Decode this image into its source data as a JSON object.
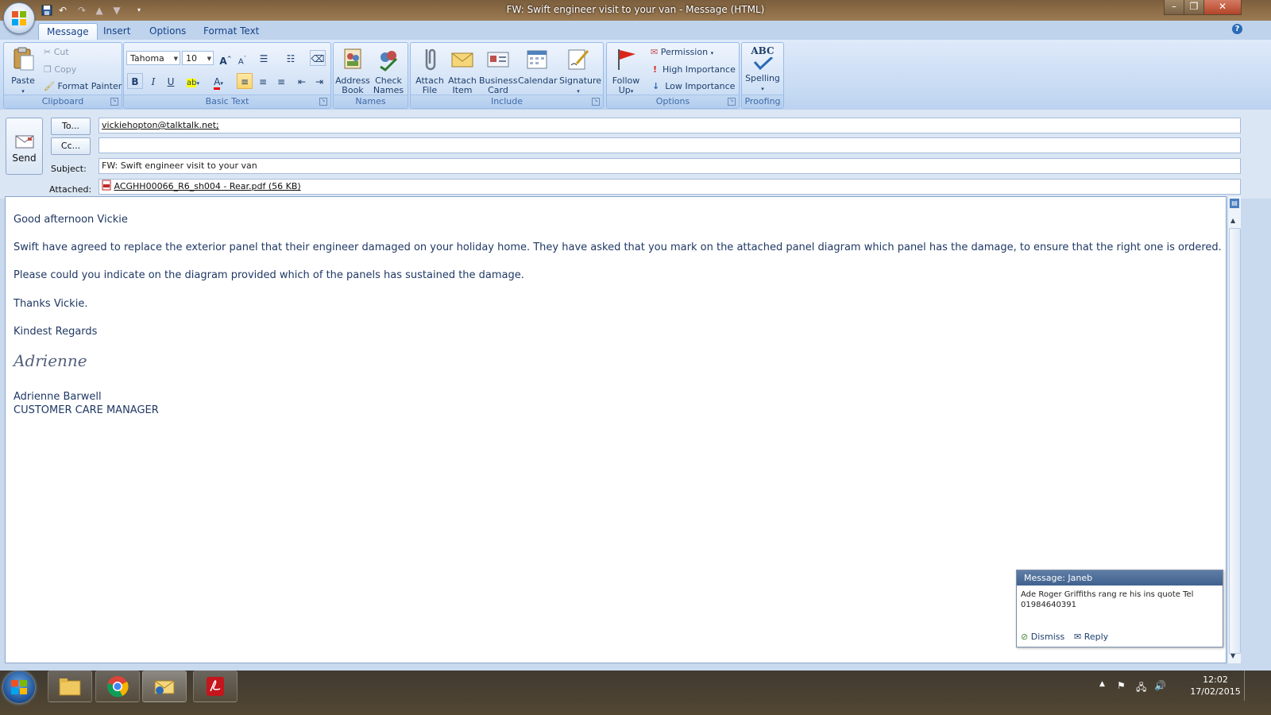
{
  "window": {
    "title": "FW: Swift engineer visit to your van - Message (HTML)"
  },
  "tabs": [
    "Message",
    "Insert",
    "Options",
    "Format Text"
  ],
  "ribbon": {
    "clipboard": {
      "label": "Clipboard",
      "paste": "Paste",
      "cut": "Cut",
      "copy": "Copy",
      "format_painter": "Format Painter"
    },
    "basic_text": {
      "label": "Basic Text",
      "font": "Tahoma",
      "size": "10"
    },
    "names": {
      "label": "Names",
      "address_book": "Address Book",
      "check_names": "Check Names"
    },
    "include": {
      "label": "Include",
      "attach_file": "Attach File",
      "attach_item": "Attach Item",
      "business_card": "Business Card",
      "calendar": "Calendar",
      "signature": "Signature"
    },
    "options": {
      "label": "Options",
      "follow_up": "Follow Up",
      "permission": "Permission",
      "high_importance": "High Importance",
      "low_importance": "Low Importance"
    },
    "proofing": {
      "label": "Proofing",
      "spelling": "Spelling",
      "abc": "ABC"
    }
  },
  "header": {
    "send": "Send",
    "to_button": "To...",
    "cc_button": "Cc...",
    "to_value": "vickiehopton@talktalk.net;",
    "cc_value": "",
    "subject_label": "Subject:",
    "subject_value": "FW: Swift engineer visit to your van",
    "attached_label": "Attached:",
    "attachment": "ACGHH00066_R6_sh004 - Rear.pdf (56 KB)"
  },
  "body": {
    "greeting": "Good afternoon Vickie",
    "p1": "Swift have agreed to replace the exterior panel that their engineer damaged on your holiday home.  They have asked that you mark on the attached panel diagram which panel has the damage, to ensure that the right one is ordered.",
    "p2": "Please could you indicate on the diagram provided which of the panels has sustained the damage.",
    "p3": "Thanks Vickie.",
    "closing": "Kindest Regards",
    "signature_script": "Adrienne",
    "sig_name": "Adrienne Barwell",
    "sig_title": "CUSTOMER CARE MANAGER"
  },
  "notification": {
    "title": "Message: Janeb",
    "text": "Ade  Roger Griffiths rang   re his ins quote Tel 01984640391",
    "dismiss": "Dismiss",
    "reply": "Reply"
  },
  "taskbar": {
    "time": "12:02",
    "date": "17/02/2015"
  },
  "colors": {
    "ribbon_blue": "#c7dbf3",
    "body_text": "#1f3864",
    "accent": "#15428b"
  }
}
